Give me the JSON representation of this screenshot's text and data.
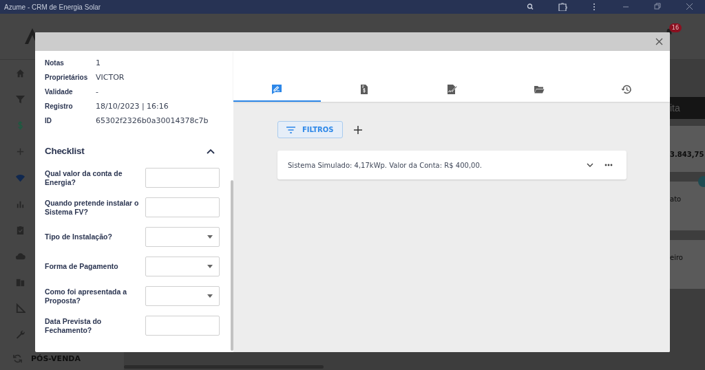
{
  "window": {
    "title": "Azume - CRM de Energia Solar"
  },
  "background_app": {
    "notification_count": "16",
    "sidebar": [
      {
        "kind": "home"
      },
      {
        "kind": "filter"
      },
      {
        "kind": "dollar"
      },
      {
        "kind": "plus"
      },
      {
        "kind": "signal"
      },
      {
        "kind": "chart"
      },
      {
        "kind": "clipboard"
      },
      {
        "kind": "cloud"
      },
      {
        "kind": "files"
      },
      {
        "kind": "ruler"
      },
      {
        "kind": "wrench"
      },
      {
        "kind": "sync",
        "label": "PÓS-VENDA"
      }
    ],
    "right_panel": {
      "header": "ita",
      "value": "3.843,75",
      "items": [
        "ato",
        "eiro"
      ]
    }
  },
  "modal": {
    "details": [
      {
        "label": "Notas",
        "value": "1"
      },
      {
        "label": "Proprietários",
        "value": "VICTOR"
      },
      {
        "label": "Validade",
        "value": "-"
      },
      {
        "label": "Registro",
        "value": "18/10/2023 | 16:16"
      },
      {
        "label": "ID",
        "value": "65302f2326b0a30014378c7b"
      }
    ],
    "checklist": {
      "title": "Checklist",
      "expanded": true,
      "questions": [
        {
          "label": "Qual valor da conta de Energia?",
          "kind": "text"
        },
        {
          "label": "Quando pretende instalar o Sistema FV?",
          "kind": "text"
        },
        {
          "label": "Tipo de Instalação?",
          "kind": "select"
        },
        {
          "label": "Forma de Pagamento",
          "kind": "select"
        },
        {
          "label": "Como foi apresentada a Proposta?",
          "kind": "select"
        },
        {
          "label": "Data Prevista do Fechamento?",
          "kind": "text"
        }
      ]
    },
    "tabs": [
      {
        "kind": "note",
        "selected": true
      },
      {
        "kind": "invoice",
        "selected": false
      },
      {
        "kind": "signature",
        "selected": false
      },
      {
        "kind": "folder",
        "selected": false
      },
      {
        "kind": "history",
        "selected": false
      }
    ],
    "filter_button": "FILTROS",
    "notes": [
      {
        "text": "Sistema Simulado: 4,17kWp. Valor da Conta: R$ 400,00.",
        "expanded": false
      }
    ]
  }
}
